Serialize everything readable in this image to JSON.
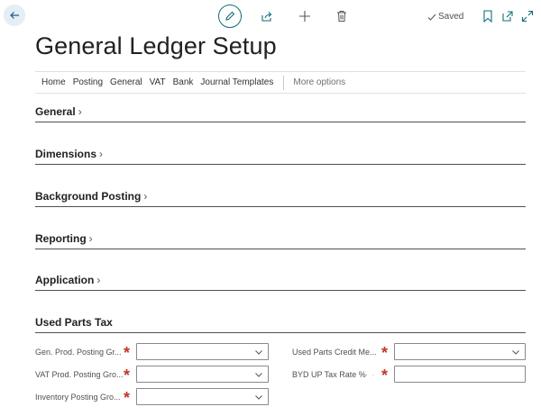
{
  "toolbar": {
    "saved_label": "Saved"
  },
  "page": {
    "title": "General Ledger Setup"
  },
  "actions": {
    "items": [
      "Home",
      "Posting",
      "General",
      "VAT",
      "Bank",
      "Journal Templates"
    ],
    "more": "More options"
  },
  "sections": {
    "general": "General",
    "dimensions": "Dimensions",
    "background_posting": "Background Posting",
    "reporting": "Reporting",
    "application": "Application",
    "used_parts_tax": "Used Parts Tax"
  },
  "fields": {
    "gen_prod": {
      "label": "Gen. Prod. Posting Gr...",
      "value": ""
    },
    "vat_prod": {
      "label": "VAT Prod. Posting Gro...",
      "value": ""
    },
    "inventory": {
      "label": "Inventory Posting Gro...",
      "value": ""
    },
    "credit_memo": {
      "label": "Used Parts Credit Me...",
      "value": ""
    },
    "byd_rate": {
      "label": "BYD UP Tax Rate %",
      "value": ""
    }
  },
  "colors": {
    "accent": "#0f6e7a",
    "required": "#c0392b",
    "back_bg": "#e4eef5"
  },
  "icons": [
    "back-arrow-icon",
    "pencil-icon",
    "share-icon",
    "plus-icon",
    "trash-icon",
    "checkmark-icon",
    "bookmark-icon",
    "open-new-window-icon",
    "expand-icon",
    "chevron-right-icon",
    "chevron-down-icon"
  ]
}
